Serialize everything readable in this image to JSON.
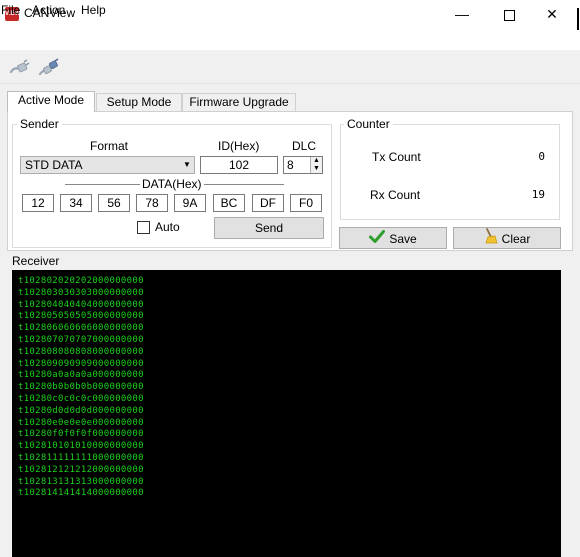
{
  "window": {
    "title": "CANView",
    "app_icon_text": "VIEW",
    "controls": {
      "minimize": "—",
      "close": "✕"
    }
  },
  "menu": {
    "file": "File",
    "action": "Action",
    "help": "Help"
  },
  "toolbar": {
    "icons": [
      "plug-connect-icon",
      "plug-disconnect-icon"
    ]
  },
  "tabs": {
    "active": "Active Mode",
    "setup": "Setup Mode",
    "firmware": "Firmware Upgrade"
  },
  "sender": {
    "title": "Sender",
    "format_label": "Format",
    "id_label": "ID(Hex)",
    "dlc_label": "DLC",
    "format_value": "STD DATA",
    "id_value": "102",
    "dlc_value": "8",
    "data_label": "DATA(Hex)",
    "data_bytes": [
      "12",
      "34",
      "56",
      "78",
      "9A",
      "BC",
      "DF",
      "F0"
    ],
    "auto_label": "Auto",
    "auto_checked": false,
    "send_label": "Send"
  },
  "counter": {
    "title": "Counter",
    "tx_label": "Tx Count",
    "tx_value": "0",
    "rx_label": "Rx Count",
    "rx_value": "19"
  },
  "actions": {
    "save_label": "Save",
    "clear_label": "Clear"
  },
  "receiver": {
    "title": "Receiver",
    "lines": [
      "t102802020202000000000",
      "t102803030303000000000",
      "t102804040404000000000",
      "t102805050505000000000",
      "t102806060606000000000",
      "t102807070707000000000",
      "t102808080808000000000",
      "t102809090909000000000",
      "t10280a0a0a0a000000000",
      "t10280b0b0b0b000000000",
      "t10280c0c0c0c000000000",
      "t10280d0d0d0d000000000",
      "t10280e0e0e0e000000000",
      "t10280f0f0f0f000000000",
      "t102810101010000000000",
      "t102811111111000000000",
      "t102812121212000000000",
      "t102813131313000000000",
      "t102814141414000000000"
    ]
  },
  "colors": {
    "receiver_bg": "#000000",
    "receiver_text": "#1bd11b",
    "save_check": "#2e9e2e"
  }
}
